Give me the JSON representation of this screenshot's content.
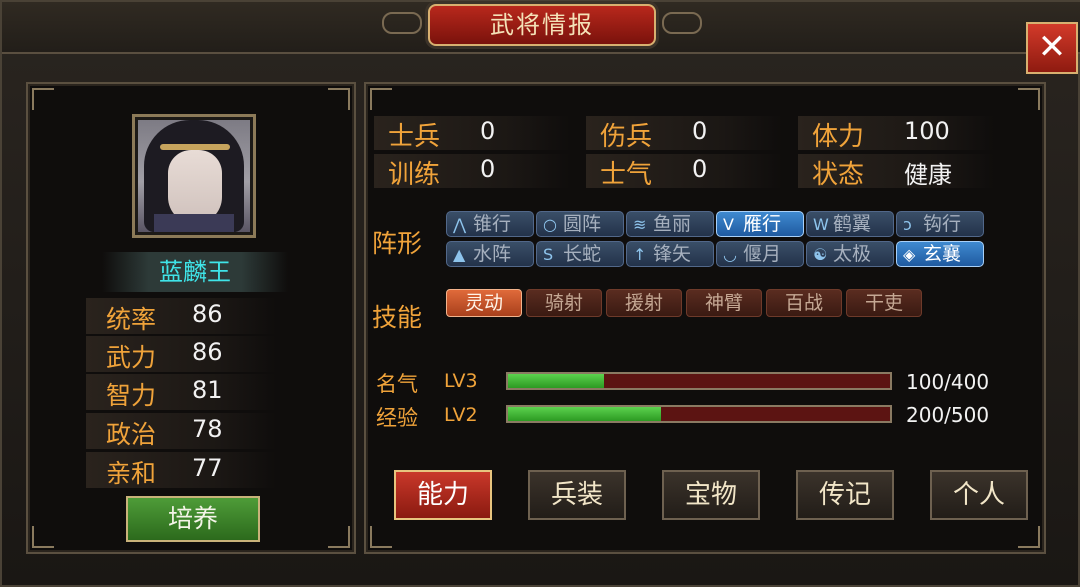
{
  "window": {
    "title": "武将情报",
    "close_label": "✕"
  },
  "general": {
    "name": "蓝麟王",
    "stats": [
      {
        "label": "统率",
        "value": "86"
      },
      {
        "label": "武力",
        "value": "86"
      },
      {
        "label": "智力",
        "value": "81"
      },
      {
        "label": "政治",
        "value": "78"
      },
      {
        "label": "亲和",
        "value": "77"
      }
    ],
    "cultivate_label": "培养"
  },
  "info": [
    {
      "label": "士兵",
      "value": "0"
    },
    {
      "label": "伤兵",
      "value": "0"
    },
    {
      "label": "体力",
      "value": "100"
    },
    {
      "label": "训练",
      "value": "0"
    },
    {
      "label": "士气",
      "value": "0"
    },
    {
      "label": "状态",
      "value": "健康"
    }
  ],
  "formation": {
    "label": "阵形",
    "items": [
      {
        "label": "锥行",
        "icon": "arrow-up-icon",
        "glyph": "⋀",
        "active": false
      },
      {
        "label": "圆阵",
        "icon": "circle-icon",
        "glyph": "○",
        "active": false
      },
      {
        "label": "鱼丽",
        "icon": "chevron-stack-icon",
        "glyph": "≋",
        "active": false
      },
      {
        "label": "雁行",
        "icon": "v-shape-icon",
        "glyph": "V",
        "active": true
      },
      {
        "label": "鹤翼",
        "icon": "wing-icon",
        "glyph": "W",
        "active": false
      },
      {
        "label": "钩行",
        "icon": "hook-icon",
        "glyph": "ↄ",
        "active": false
      },
      {
        "label": "水阵",
        "icon": "house-icon",
        "glyph": "▲",
        "active": false
      },
      {
        "label": "长蛇",
        "icon": "snake-icon",
        "glyph": "S",
        "active": false
      },
      {
        "label": "锋矢",
        "icon": "arrowhead-icon",
        "glyph": "↑",
        "active": false
      },
      {
        "label": "偃月",
        "icon": "crescent-icon",
        "glyph": "◡",
        "active": false
      },
      {
        "label": "太极",
        "icon": "taiji-icon",
        "glyph": "☯",
        "active": false
      },
      {
        "label": "玄襄",
        "icon": "diamond-icon",
        "glyph": "◈",
        "active": true
      }
    ]
  },
  "skills": {
    "label": "技能",
    "items": [
      {
        "label": "灵动",
        "active": true
      },
      {
        "label": "骑射",
        "active": false
      },
      {
        "label": "援射",
        "active": false
      },
      {
        "label": "神臂",
        "active": false
      },
      {
        "label": "百战",
        "active": false
      },
      {
        "label": "干吏",
        "active": false
      }
    ]
  },
  "progress": [
    {
      "label": "名气",
      "level": "LV3",
      "text": "100/400",
      "fraction": 0.25
    },
    {
      "label": "经验",
      "level": "LV2",
      "text": "200/500",
      "fraction": 0.4
    }
  ],
  "tabs": [
    {
      "label": "能力",
      "active": true
    },
    {
      "label": "兵装",
      "active": false
    },
    {
      "label": "宝物",
      "active": false
    },
    {
      "label": "传记",
      "active": false
    },
    {
      "label": "个人",
      "active": false
    }
  ],
  "colors": {
    "accent": "#f0a33a",
    "name": "#3fe4e8",
    "active_tab": "#c9382a",
    "bar_fill": "#3cb830"
  }
}
